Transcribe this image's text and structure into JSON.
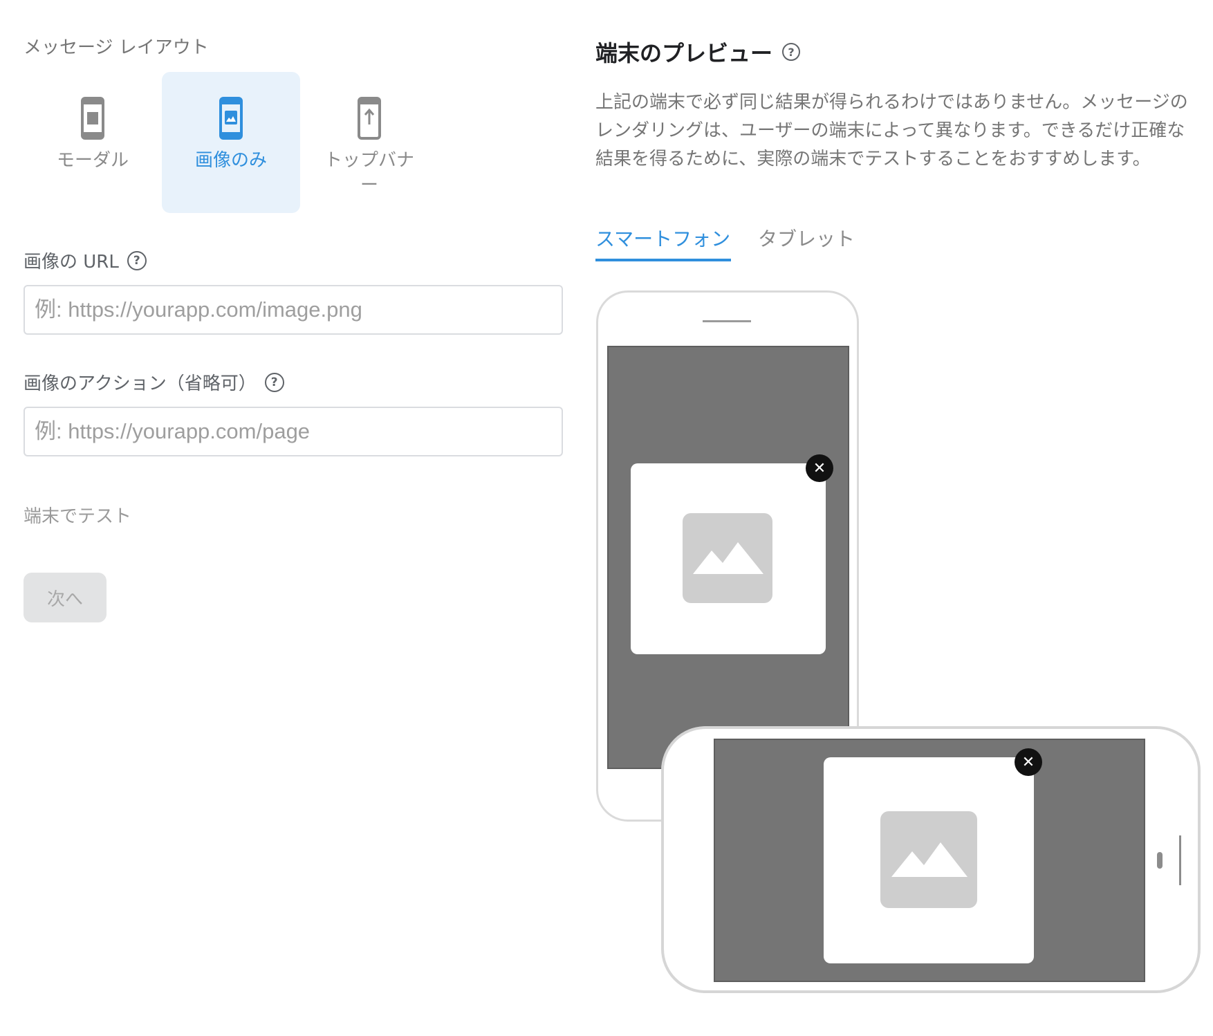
{
  "left": {
    "layout_label": "メッセージ レイアウト",
    "layout_options": [
      {
        "label": "モーダル",
        "selected": false,
        "icon": "phone-modal-icon"
      },
      {
        "label": "画像のみ",
        "selected": true,
        "icon": "phone-image-icon"
      },
      {
        "label": "トップバナー",
        "selected": false,
        "icon": "phone-top-banner-icon"
      }
    ],
    "image_url": {
      "label": "画像の URL",
      "placeholder": "例: https://yourapp.com/image.png",
      "value": ""
    },
    "image_action": {
      "label": "画像のアクション（省略可）",
      "placeholder": "例: https://yourapp.com/page",
      "value": ""
    },
    "test_label": "端末でテスト",
    "next_button": "次へ"
  },
  "right": {
    "title": "端末のプレビュー",
    "description": "上記の端末で必ず同じ結果が得られるわけではありません。メッセージのレンダリングは、ユーザーの端末によって異なります。できるだけ正確な結果を得るために、実際の端末でテストすることをおすすめします。",
    "tabs": [
      {
        "label": "スマートフォン",
        "active": true
      },
      {
        "label": "タブレット",
        "active": false
      }
    ]
  },
  "icons": {
    "help": "?",
    "close": "✕"
  },
  "colors": {
    "accent": "#2f8fdd",
    "selected_bg": "#e8f2fb",
    "screen_gray": "#757575",
    "placeholder_gray": "#cecece",
    "disabled_button_bg": "#e2e3e4"
  }
}
